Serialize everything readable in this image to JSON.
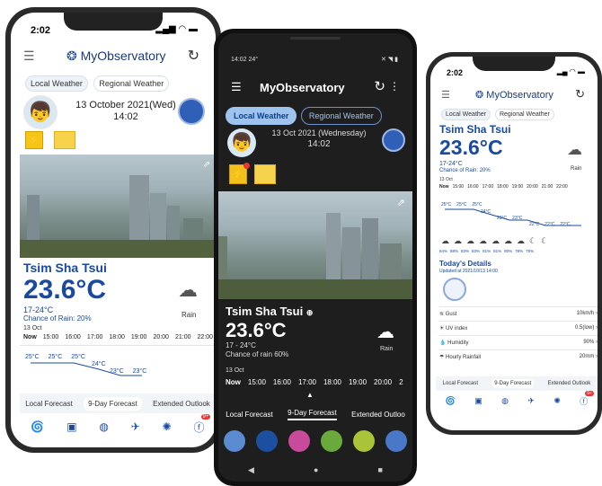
{
  "phone1": {
    "time": "2:02",
    "app_title": "MyObservatory",
    "tabs": [
      "Local Weather",
      "Regional Weather"
    ],
    "date": "13 October 2021(Wed)",
    "clock": "14:02",
    "location": "Tsim Sha Tsui",
    "temp": "23.6°C",
    "range": "17-24°C",
    "rain": "Chance of Rain: 20%",
    "weather": "Rain",
    "date_short": "13 Oct",
    "hours": [
      "Now",
      "15:00",
      "16:00",
      "17:00",
      "18:00",
      "19:00",
      "20:00",
      "21:00",
      "22:00"
    ],
    "temps_row1": [
      "25°C",
      "25°C",
      "25°C"
    ],
    "temps_row2": [
      "24°C"
    ],
    "temps_row3": [
      "23°C",
      "23°C"
    ],
    "forecast_tabs": [
      "Local Forecast",
      "9-Day Forecast",
      "Extended Outlook"
    ],
    "badge": "9+"
  },
  "phone2": {
    "time": "14:02",
    "time_extra": "24°",
    "app_title": "MyObservatory",
    "tabs": [
      "Local Weather",
      "Regional Weather"
    ],
    "date": "13 Oct 2021 (Wednesday)",
    "clock": "14:02",
    "location": "Tsim Sha Tsui",
    "temp": "23.6°C",
    "range": "17 - 24°C",
    "rain": "Chance of rain 60%",
    "weather": "Rain",
    "date_short": "13 Oct",
    "hours": [
      "Now",
      "15:00",
      "16:00",
      "17:00",
      "18:00",
      "19:00",
      "20:00",
      "2"
    ],
    "forecast_tabs": [
      "Local Forecast",
      "9-Day Forecast",
      "Extended Outloo"
    ]
  },
  "phone3": {
    "time": "2:02",
    "app_title": "MyObservatory",
    "tabs": [
      "Local Weather",
      "Regional Weather"
    ],
    "location": "Tsim Sha Tsui",
    "temp": "23.6°C",
    "range": "17-24°C",
    "rain": "Chance of Rain: 20%",
    "weather": "Rain",
    "date_short": "13 Oct",
    "hours": [
      "Now",
      "15:00",
      "16:00",
      "17:00",
      "18:00",
      "19:00",
      "20:00",
      "21:00",
      "22:00"
    ],
    "temps_row1": [
      "25°C",
      "25°C",
      "25°C"
    ],
    "temps_row2": [
      "24°C"
    ],
    "temps_row3": [
      "23°C",
      "23°C"
    ],
    "temps_row4": [
      "22°C",
      "22°C",
      "22°C"
    ],
    "humidity_row": [
      "84%",
      "88%",
      "83%",
      "83%",
      "81%",
      "81%",
      "80%",
      "78%",
      "75%"
    ],
    "details_title": "Today's Details",
    "details_updated": "Updated at 2021/10/13 14:00",
    "details": [
      {
        "label": "Gust",
        "value": "10km/h"
      },
      {
        "label": "UV index",
        "value": "0.5(low)"
      },
      {
        "label": "Humidity",
        "value": "90%"
      },
      {
        "label": "Hourly Rainfall",
        "value": "20mm"
      }
    ],
    "forecast_tabs": [
      "Local Forecast",
      "9-Day Forecast",
      "Extended Outlook"
    ],
    "badge": "9+"
  },
  "colors": {
    "brand": "#1a4aa0",
    "tab_active": "#9ec3ee",
    "dark_bg": "#1e1e1e"
  }
}
